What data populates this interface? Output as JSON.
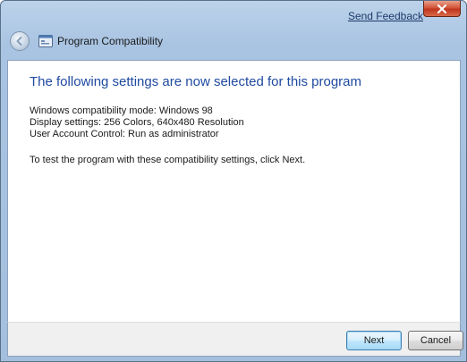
{
  "window": {
    "title": "Program Compatibility",
    "send_feedback_label": "Send Feedback",
    "close_icon": "close-icon",
    "back_icon": "back-arrow-icon",
    "app_icon": "compatibility-app-icon"
  },
  "content": {
    "heading": "The following settings are now selected for this program",
    "settings": [
      "Windows compatibility mode: Windows 98",
      "Display settings: 256 Colors, 640x480 Resolution",
      "User Account Control: Run as administrator"
    ],
    "instruction": "To test the program with these compatibility settings, click Next."
  },
  "footer": {
    "next_label": "Next",
    "cancel_label": "Cancel"
  },
  "colors": {
    "heading": "#1f4aa0",
    "frame": "#a9c4e2",
    "close": "#c0341c"
  }
}
